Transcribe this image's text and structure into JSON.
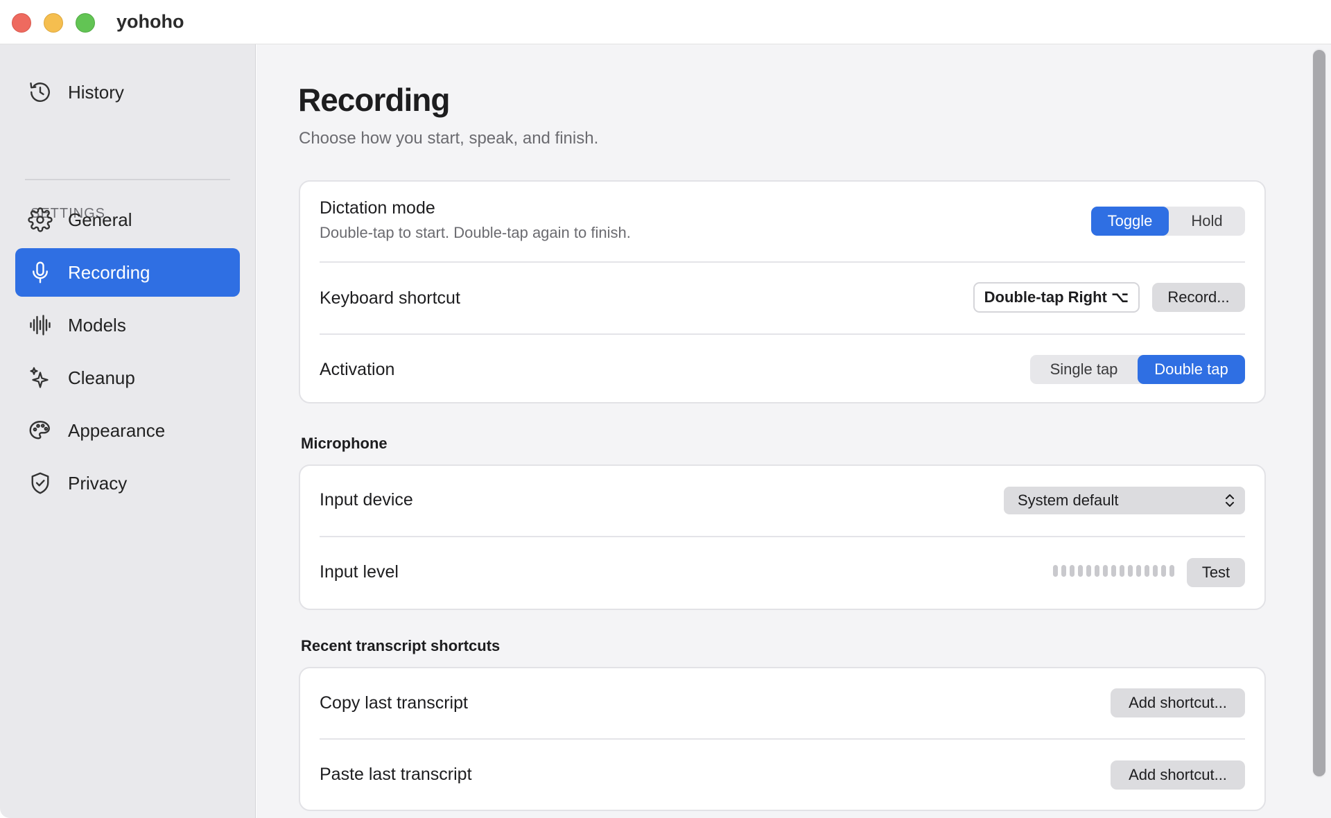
{
  "window": {
    "title": "yohoho"
  },
  "sidebar": {
    "history": {
      "label": "History",
      "icon": "history-icon"
    },
    "section_label": "SETTINGS",
    "items": [
      {
        "label": "General",
        "icon": "gear-icon",
        "active": false
      },
      {
        "label": "Recording",
        "icon": "microphone-icon",
        "active": true
      },
      {
        "label": "Models",
        "icon": "waveform-icon",
        "active": false
      },
      {
        "label": "Cleanup",
        "icon": "sparkles-icon",
        "active": false
      },
      {
        "label": "Appearance",
        "icon": "palette-icon",
        "active": false
      },
      {
        "label": "Privacy",
        "icon": "shield-check-icon",
        "active": false
      }
    ]
  },
  "main": {
    "title": "Recording",
    "subtitle": "Choose how you start, speak, and finish.",
    "dictation": {
      "title": "Dictation mode",
      "description": "Double-tap to start. Double-tap again to finish.",
      "options": [
        "Toggle",
        "Hold"
      ],
      "selected": "Toggle"
    },
    "shortcut": {
      "title": "Keyboard shortcut",
      "value": "Double-tap Right ⌥",
      "record_label": "Record..."
    },
    "activation": {
      "title": "Activation",
      "options": [
        "Single tap",
        "Double tap"
      ],
      "selected": "Double tap"
    },
    "microphone": {
      "heading": "Microphone",
      "input_device_title": "Input device",
      "input_device_value": "System default",
      "input_level_title": "Input level",
      "input_level": 0,
      "test_label": "Test"
    },
    "recent": {
      "heading": "Recent transcript shortcuts",
      "copy_title": "Copy last transcript",
      "copy_button": "Add shortcut...",
      "paste_title": "Paste last transcript",
      "paste_button": "Add shortcut..."
    }
  },
  "colors": {
    "accent": "#2f6fe3",
    "sidebar_bg": "#e9e9ec",
    "main_bg": "#f4f4f6"
  }
}
